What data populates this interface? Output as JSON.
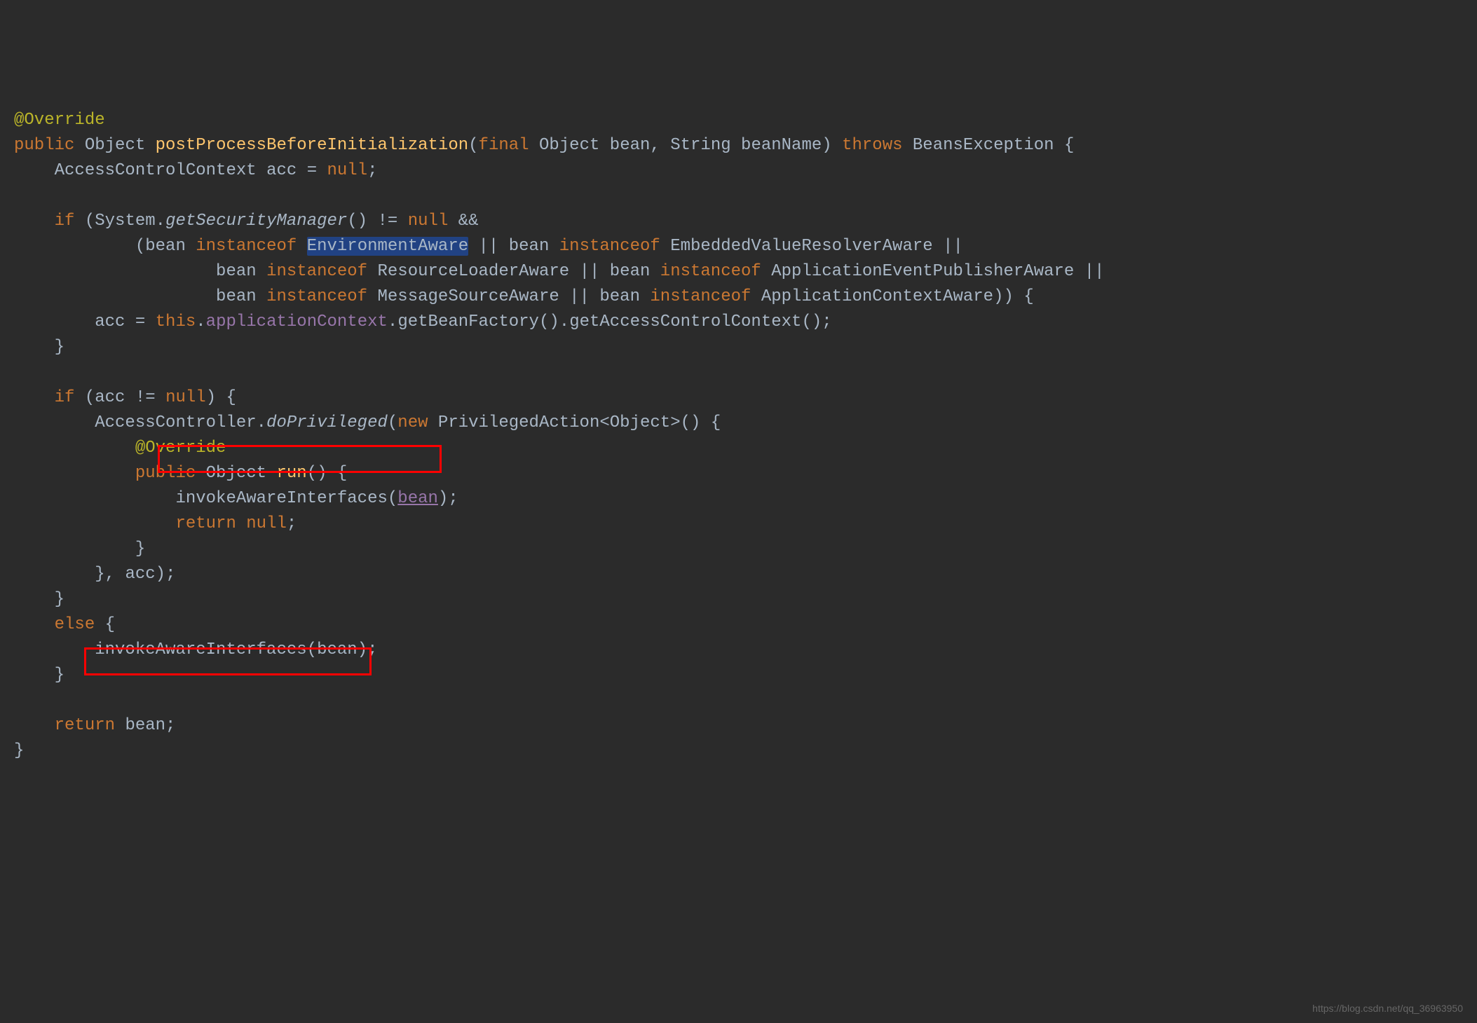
{
  "code": {
    "line1": {
      "annotation": "@Override"
    },
    "line2": {
      "kw_public": "public",
      "type_object": "Object",
      "method": "postProcessBeforeInitialization",
      "paren_open": "(",
      "kw_final": "final",
      "type_obj2": "Object",
      "param_bean": "bean",
      "comma": ",",
      "type_string": "String",
      "param_name": "beanName",
      "paren_close": ")",
      "kw_throws": "throws",
      "exc": "BeansException",
      "brace": "{"
    },
    "line3": {
      "indent": "    ",
      "type": "AccessControlContext",
      "var": "acc",
      "eq": "=",
      "kw_null": "null",
      "semi": ";"
    },
    "line5": {
      "indent": "    ",
      "kw_if": "if",
      "paren": "(",
      "cls": "System",
      "dot": ".",
      "method": "getSecurityManager",
      "parens": "()",
      "ne": "!=",
      "kw_null": "null",
      "and": "&&"
    },
    "line6": {
      "indent": "            ",
      "paren": "(",
      "bean": "bean",
      "kw_inst": "instanceof",
      "type1": "EnvironmentAware",
      "or": "||",
      "bean2": "bean",
      "kw_inst2": "instanceof",
      "type2": "EmbeddedValueResolverAware",
      "or2": "||"
    },
    "line7": {
      "indent": "                    ",
      "bean": "bean",
      "kw_inst": "instanceof",
      "type1": "ResourceLoaderAware",
      "or": "||",
      "bean2": "bean",
      "kw_inst2": "instanceof",
      "type2": "ApplicationEventPublisherAware",
      "or2": "||"
    },
    "line8": {
      "indent": "                    ",
      "bean": "bean",
      "kw_inst": "instanceof",
      "type1": "MessageSourceAware",
      "or": "||",
      "bean2": "bean",
      "kw_inst2": "instanceof",
      "type2": "ApplicationContextAware",
      "parens": "))",
      "brace": "{"
    },
    "line9": {
      "indent": "        ",
      "var": "acc",
      "eq": "=",
      "kw_this": "this",
      "dot": ".",
      "field": "applicationContext",
      "dot2": ".",
      "method1": "getBeanFactory",
      "parens1": "()",
      "dot3": ".",
      "method2": "getAccessControlContext",
      "parens2": "()",
      "semi": ";"
    },
    "line10": {
      "indent": "    ",
      "brace": "}"
    },
    "line12": {
      "indent": "    ",
      "kw_if": "if",
      "paren": "(",
      "var": "acc",
      "ne": "!=",
      "kw_null": "null",
      "paren2": ")",
      "brace": "{"
    },
    "line13": {
      "indent": "        ",
      "cls": "AccessController",
      "dot": ".",
      "method": "doPrivileged",
      "paren": "(",
      "kw_new": "new",
      "type": "PrivilegedAction",
      "lt": "<",
      "gen": "Object",
      "gt": ">",
      "parens": "()",
      "brace": "{"
    },
    "line14": {
      "indent": "            ",
      "annotation": "@Override"
    },
    "line15": {
      "indent": "            ",
      "kw_public": "public",
      "type": "Object",
      "method": "run",
      "parens": "()",
      "brace": "{"
    },
    "line16": {
      "indent": "                ",
      "method": "invokeAwareInterfaces",
      "paren": "(",
      "param": "bean",
      "paren2": ")",
      "semi": ";"
    },
    "line17": {
      "indent": "                ",
      "kw_return": "return",
      "kw_null": "null",
      "semi": ";"
    },
    "line18": {
      "indent": "            ",
      "brace": "}"
    },
    "line19": {
      "indent": "        ",
      "brace": "}",
      "comma": ",",
      "var": "acc",
      "paren": ")",
      "semi": ";"
    },
    "line20": {
      "indent": "    ",
      "brace": "}"
    },
    "line21": {
      "indent": "    ",
      "kw_else": "else",
      "brace": "{"
    },
    "line22": {
      "indent": "        ",
      "method": "invokeAwareInterfaces",
      "paren": "(",
      "param": "bean",
      "paren2": ")",
      "semi": ";"
    },
    "line23": {
      "indent": "    ",
      "brace": "}"
    },
    "line25": {
      "indent": "    ",
      "kw_return": "return",
      "var": "bean",
      "semi": ";"
    },
    "line26": {
      "brace": "}"
    }
  },
  "watermark": "https://blog.csdn.net/qq_36963950"
}
